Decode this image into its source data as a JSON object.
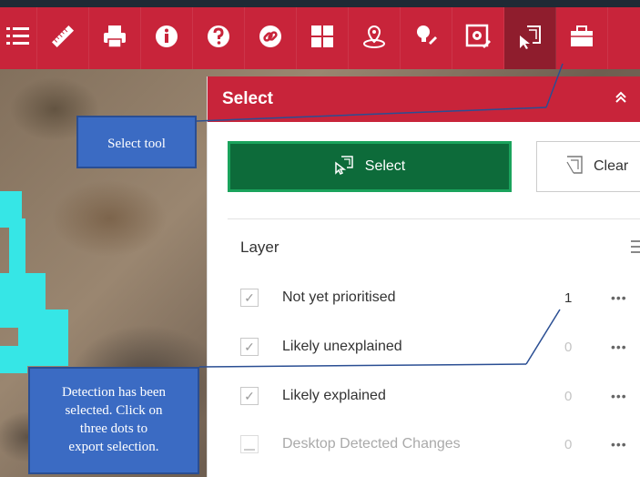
{
  "toolbar": {
    "tools": [
      {
        "icon": "layer-list-icon",
        "active": false
      },
      {
        "icon": "measure-ruler-icon",
        "active": false
      },
      {
        "icon": "print-icon",
        "active": false
      },
      {
        "icon": "info-icon",
        "active": false
      },
      {
        "icon": "help-icon",
        "active": false
      },
      {
        "icon": "link-icon",
        "active": false
      },
      {
        "icon": "basemap-gallery-icon",
        "active": false
      },
      {
        "icon": "location-pin-icon",
        "active": false
      },
      {
        "icon": "paintbrush-icon",
        "active": false
      },
      {
        "icon": "settings-edit-icon",
        "active": false
      },
      {
        "icon": "select-tool-icon",
        "active": true
      },
      {
        "icon": "briefcase-icon",
        "active": false
      }
    ]
  },
  "panel": {
    "title": "Select",
    "select_button_label": "Select",
    "clear_button_label": "Clear",
    "layer_header": "Layer",
    "layers": [
      {
        "label": "Not yet prioritised",
        "count": "1",
        "checked": true,
        "enabled": true
      },
      {
        "label": "Likely unexplained",
        "count": "0",
        "checked": true,
        "enabled": true
      },
      {
        "label": "Likely explained",
        "count": "0",
        "checked": true,
        "enabled": true
      },
      {
        "label": "Desktop Detected Changes",
        "count": "0",
        "checked": false,
        "enabled": false
      }
    ],
    "more_label": "•••"
  },
  "annotations": {
    "select_tool": "Select tool",
    "detection_lines": [
      "Detection has been",
      "selected. Click on",
      "three dots to",
      "export selection."
    ]
  },
  "colors": {
    "toolbar_red": "#c8243a",
    "active_tool": "#8f1d2d",
    "select_button_green": "#0d6b3a",
    "callout_blue": "#3b6bc3",
    "detection_cyan": "#36e6e6"
  }
}
